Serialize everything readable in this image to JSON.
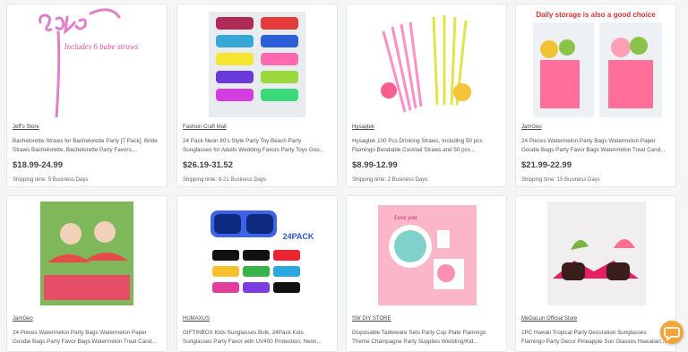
{
  "products": [
    {
      "store": "Jeff's Store",
      "title": "Bachelorette Straws for Bachelorette Party [7 Pack], Bride Straws Bachelorette, Bachelorette Party Favors,...",
      "price": "$18.99-24.99",
      "shipping": "Shipping time: 5 Business Days",
      "image_text": "Includes 6 babe straws",
      "image_icon": "babe-straw-image"
    },
    {
      "store": "Fashion Craft Mall",
      "title": "24 Pack Neon 80's Style Party Toy Beach Party Sunglasses for Adults Wedding Favors Party Toys Goo...",
      "price": "$26.19-31.52",
      "shipping": "Shipping time: 8-21 Business Days",
      "image_icon": "neon-sunglasses-image"
    },
    {
      "store": "Hysagtek",
      "title": "Hysagtek 100 Pcs Drinking Straws, Including 50 pcs Flamingo Bendable Cocktail Straws and 50 pcs...",
      "price": "$8.99-12.99",
      "shipping": "Shipping time: 2 Business Days",
      "image_icon": "flamingo-straws-image"
    },
    {
      "store": "JamGeo",
      "title": "24 Pieces Watermelon Party Bags Watermelon Paper Goodie Bags Party Favor Bags Watermelon Treat Cand...",
      "price": "$21.99-22.99",
      "shipping": "Shipping time: 15 Business Days",
      "image_text": "Daily storage is also a good choice",
      "image_icon": "watermelon-bags-image"
    },
    {
      "store": "JamGeo",
      "title": "24 Pieces Watermelon Party Bags Watermelon Paper Goodie Bags Party Favor Bags Watermelon Treat Cand...",
      "image_icon": "kids-watermelon-image"
    },
    {
      "store": "HUMAXUS",
      "title": "GIFTINBOX Kids Sunglasses Bulk, 24Pack Kids Sunglasses Party Favor with UV400 Protection, Neon...",
      "image_text": "24PACK",
      "image_icon": "kids-sunglasses-image"
    },
    {
      "store": "SW DIY STORE",
      "title": "Disposable Tableware Sets Party Cup Plate Flamingo Theme Champagne Party Supplies Wedding/Kid...",
      "image_text": "Love you",
      "image_icon": "flamingo-tableware-image"
    },
    {
      "store": "MeGaLun Official Store",
      "title": "1PC Hawaii Tropical Party Decoration Sunglasses Flamingo Party Decor Pineapple Sun Glasses Hawaiian...",
      "image_icon": "hawaii-sunglasses-image"
    }
  ],
  "chat": {
    "icon": "chat-icon"
  },
  "colors": {
    "accent": "#f3a53a",
    "price": "#444444",
    "link": "#445566"
  }
}
